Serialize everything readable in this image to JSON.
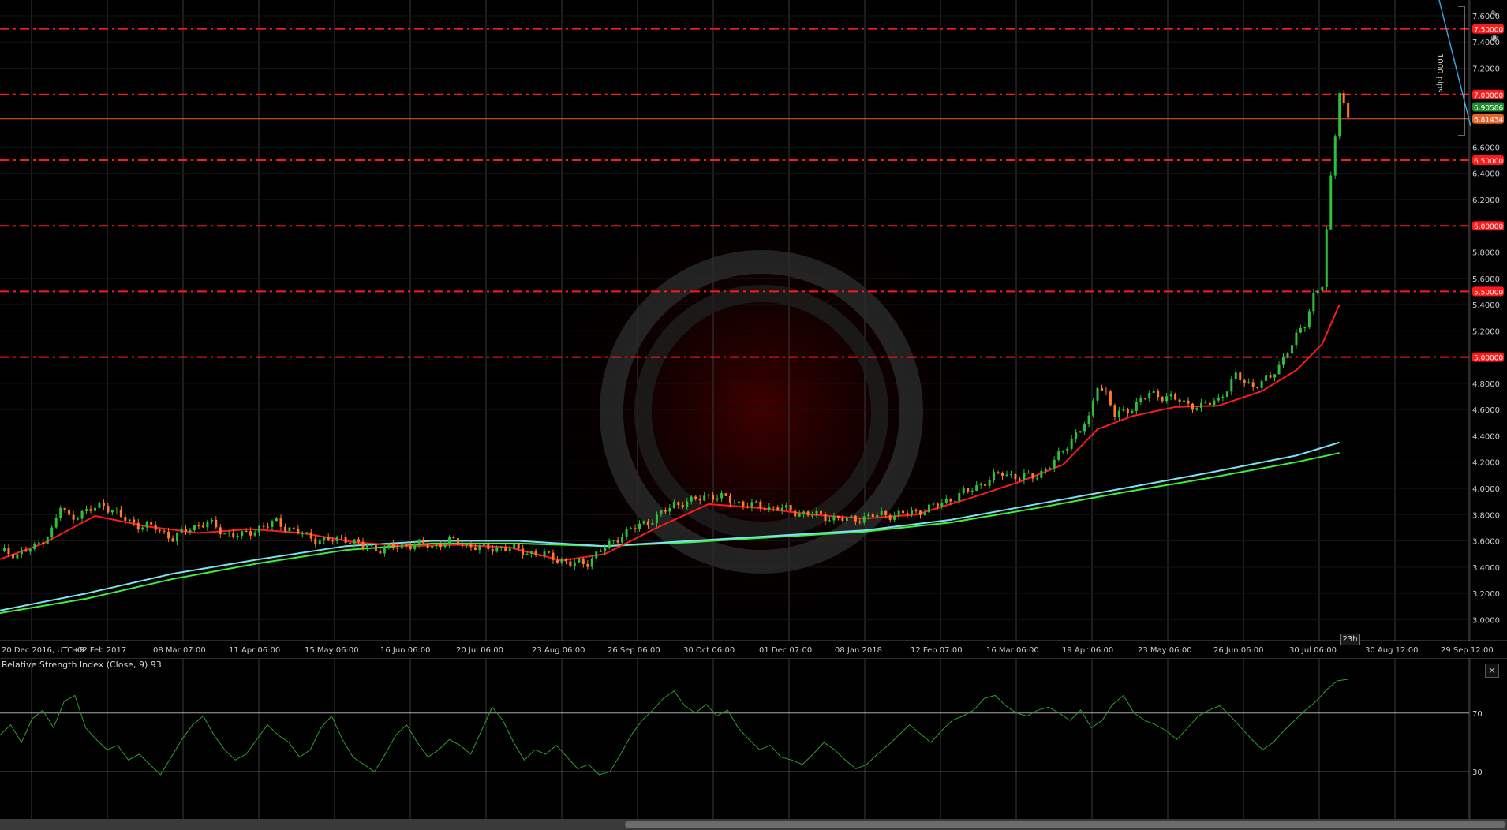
{
  "chart_data": [
    {
      "type": "candlestick",
      "ylim": [
        2.84,
        7.72
      ],
      "y_ticks": [
        "3.0000",
        "3.2000",
        "3.4000",
        "3.6000",
        "3.8000",
        "4.0000",
        "4.2000",
        "4.4000",
        "4.6000",
        "4.8000",
        "5.2000",
        "5.4000",
        "5.6000",
        "5.8000",
        "6.2000",
        "6.4000",
        "6.6000",
        "7.2000",
        "7.4000",
        "7.6000"
      ],
      "x_tick_labels": [
        "20 Dec 2016, UTC+9",
        "02 Feb 2017",
        "08 Mar 07:00",
        "11 Apr 06:00",
        "15 May 06:00",
        "16 Jun 06:00",
        "20 Jul 06:00",
        "23 Aug 06:00",
        "26 Sep 06:00",
        "30 Oct 06:00",
        "01 Dec 07:00",
        "08 Jan 2018",
        "12 Feb 07:00",
        "16 Mar 06:00",
        "19 Apr 06:00",
        "23 May 06:00",
        "26 Jun 06:00",
        "30 Jul 06:00",
        "30 Aug 12:00",
        "29 Sep 12:00"
      ],
      "horizontal_levels": [
        {
          "value": 7.5,
          "label": "7.50000",
          "color": "#ff1a1a"
        },
        {
          "value": 7.0,
          "label": "7.00000",
          "color": "#ff1a1a"
        },
        {
          "value": 6.5,
          "label": "6.50000",
          "color": "#ff1a1a"
        },
        {
          "value": 6.0,
          "label": "6.00000",
          "color": "#ff1a1a"
        },
        {
          "value": 5.5,
          "label": "5.50000",
          "color": "#ff1a1a"
        },
        {
          "value": 5.0,
          "label": "5.00000",
          "color": "#ff1a1a"
        }
      ],
      "price_markers": [
        {
          "value": 6.90586,
          "label": "6.90586",
          "color": "#1f8a2e"
        },
        {
          "value": 6.81434,
          "label": "6.81434",
          "color": "#e8632b"
        }
      ],
      "price_path": [
        [
          0,
          3.52
        ],
        [
          4,
          3.5
        ],
        [
          8,
          3.55
        ],
        [
          12,
          3.68
        ],
        [
          14,
          3.86
        ],
        [
          16,
          3.78
        ],
        [
          20,
          3.82
        ],
        [
          24,
          3.88
        ],
        [
          28,
          3.78
        ],
        [
          32,
          3.72
        ],
        [
          36,
          3.7
        ],
        [
          40,
          3.62
        ],
        [
          44,
          3.7
        ],
        [
          48,
          3.74
        ],
        [
          52,
          3.66
        ],
        [
          56,
          3.64
        ],
        [
          60,
          3.7
        ],
        [
          64,
          3.74
        ],
        [
          68,
          3.68
        ],
        [
          72,
          3.62
        ],
        [
          76,
          3.6
        ],
        [
          80,
          3.62
        ],
        [
          84,
          3.56
        ],
        [
          88,
          3.54
        ],
        [
          92,
          3.55
        ],
        [
          96,
          3.58
        ],
        [
          100,
          3.56
        ],
        [
          104,
          3.6
        ],
        [
          108,
          3.57
        ],
        [
          112,
          3.54
        ],
        [
          116,
          3.55
        ],
        [
          120,
          3.53
        ],
        [
          124,
          3.5
        ],
        [
          128,
          3.48
        ],
        [
          132,
          3.42
        ],
        [
          136,
          3.44
        ],
        [
          140,
          3.55
        ],
        [
          144,
          3.65
        ],
        [
          148,
          3.72
        ],
        [
          152,
          3.78
        ],
        [
          156,
          3.88
        ],
        [
          160,
          3.9
        ],
        [
          164,
          3.95
        ],
        [
          168,
          3.92
        ],
        [
          172,
          3.88
        ],
        [
          176,
          3.86
        ],
        [
          180,
          3.85
        ],
        [
          184,
          3.82
        ],
        [
          188,
          3.8
        ],
        [
          192,
          3.78
        ],
        [
          196,
          3.76
        ],
        [
          200,
          3.78
        ],
        [
          204,
          3.8
        ],
        [
          208,
          3.8
        ],
        [
          212,
          3.82
        ],
        [
          216,
          3.86
        ],
        [
          220,
          3.92
        ],
        [
          224,
          3.98
        ],
        [
          228,
          4.05
        ],
        [
          232,
          4.12
        ],
        [
          236,
          4.08
        ],
        [
          240,
          4.1
        ],
        [
          244,
          4.2
        ],
        [
          248,
          4.38
        ],
        [
          252,
          4.52
        ],
        [
          254,
          4.8
        ],
        [
          256,
          4.72
        ],
        [
          258,
          4.55
        ],
        [
          262,
          4.62
        ],
        [
          266,
          4.72
        ],
        [
          270,
          4.7
        ],
        [
          274,
          4.65
        ],
        [
          278,
          4.62
        ],
        [
          282,
          4.68
        ],
        [
          286,
          4.85
        ],
        [
          290,
          4.78
        ],
        [
          294,
          4.84
        ],
        [
          298,
          5.05
        ],
        [
          302,
          5.25
        ],
        [
          304,
          5.48
        ],
        [
          306,
          5.55
        ],
        [
          308,
          6.35
        ],
        [
          310,
          7.04
        ],
        [
          312,
          6.82
        ]
      ],
      "ema_short_path": [
        [
          0,
          3.46
        ],
        [
          10,
          3.58
        ],
        [
          22,
          3.79
        ],
        [
          34,
          3.71
        ],
        [
          46,
          3.66
        ],
        [
          58,
          3.69
        ],
        [
          70,
          3.66
        ],
        [
          82,
          3.59
        ],
        [
          94,
          3.56
        ],
        [
          106,
          3.57
        ],
        [
          118,
          3.55
        ],
        [
          130,
          3.45
        ],
        [
          140,
          3.5
        ],
        [
          152,
          3.7
        ],
        [
          164,
          3.88
        ],
        [
          176,
          3.85
        ],
        [
          188,
          3.8
        ],
        [
          200,
          3.77
        ],
        [
          212,
          3.8
        ],
        [
          224,
          3.92
        ],
        [
          236,
          4.05
        ],
        [
          246,
          4.18
        ],
        [
          254,
          4.45
        ],
        [
          262,
          4.55
        ],
        [
          272,
          4.62
        ],
        [
          282,
          4.63
        ],
        [
          292,
          4.74
        ],
        [
          300,
          4.9
        ],
        [
          306,
          5.1
        ],
        [
          310,
          5.4
        ]
      ],
      "ma_long_cyan_path": [
        [
          0,
          3.07
        ],
        [
          20,
          3.2
        ],
        [
          40,
          3.35
        ],
        [
          60,
          3.46
        ],
        [
          80,
          3.56
        ],
        [
          100,
          3.6
        ],
        [
          120,
          3.6
        ],
        [
          140,
          3.56
        ],
        [
          160,
          3.6
        ],
        [
          180,
          3.64
        ],
        [
          200,
          3.68
        ],
        [
          220,
          3.76
        ],
        [
          240,
          3.88
        ],
        [
          260,
          4.0
        ],
        [
          280,
          4.12
        ],
        [
          300,
          4.25
        ],
        [
          310,
          4.35
        ]
      ],
      "ma_long_green_path": [
        [
          0,
          3.05
        ],
        [
          20,
          3.16
        ],
        [
          40,
          3.31
        ],
        [
          60,
          3.43
        ],
        [
          80,
          3.53
        ],
        [
          100,
          3.58
        ],
        [
          120,
          3.58
        ],
        [
          140,
          3.56
        ],
        [
          160,
          3.59
        ],
        [
          180,
          3.63
        ],
        [
          200,
          3.67
        ],
        [
          220,
          3.74
        ],
        [
          240,
          3.85
        ],
        [
          260,
          3.97
        ],
        [
          280,
          4.08
        ],
        [
          300,
          4.2
        ],
        [
          310,
          4.27
        ]
      ],
      "colors": {
        "up": "#2fbf3a",
        "down": "#ff7a2a",
        "ema_short": "#ff1a1a",
        "ma_cyan": "#7fe0f0",
        "ma_green": "#3cf03c",
        "grid": "#3a3a3a"
      }
    },
    {
      "type": "line",
      "title": "Relative Strength Index (Close, 9) 93",
      "ylim": [
        0,
        100
      ],
      "reference_levels": [
        70,
        30
      ],
      "reference_labels": [
        "70",
        "30"
      ],
      "series": [
        {
          "values": [
            55,
            62,
            50,
            66,
            72,
            60,
            78,
            82,
            60,
            52,
            45,
            48,
            38,
            42,
            35,
            28,
            40,
            52,
            62,
            68,
            55,
            45,
            38,
            42,
            52,
            62,
            55,
            50,
            40,
            45,
            60,
            68,
            52,
            40,
            35,
            30,
            42,
            55,
            62,
            50,
            40,
            45,
            52,
            48,
            42,
            58,
            74,
            65,
            50,
            38,
            45,
            42,
            48,
            40,
            32,
            35,
            28,
            30,
            42,
            55,
            65,
            72,
            80,
            85,
            75,
            70,
            76,
            68,
            72,
            60,
            52,
            45,
            48,
            40,
            38,
            35,
            42,
            50,
            45,
            38,
            32,
            35,
            42,
            48,
            55,
            62,
            56,
            50,
            58,
            65,
            68,
            72,
            80,
            82,
            75,
            70,
            68,
            72,
            74,
            70,
            65,
            72,
            60,
            65,
            76,
            82,
            70,
            65,
            62,
            58,
            52,
            60,
            68,
            72,
            75,
            68,
            60,
            52,
            45,
            50,
            58,
            65,
            72,
            78,
            86,
            92,
            93
          ]
        }
      ],
      "colors": {
        "line": "#2e9e2e",
        "reference": "#d0d0d0"
      }
    }
  ],
  "rsi_label": "Relative Strength Index (Close, 9) 93",
  "rsi_close_label": "✕",
  "cursor_time_badge": "23h",
  "scale_note": "1000 pips",
  "icons": {
    "draw_tool": "pencil-icon",
    "snapshot": "camera-icon"
  }
}
